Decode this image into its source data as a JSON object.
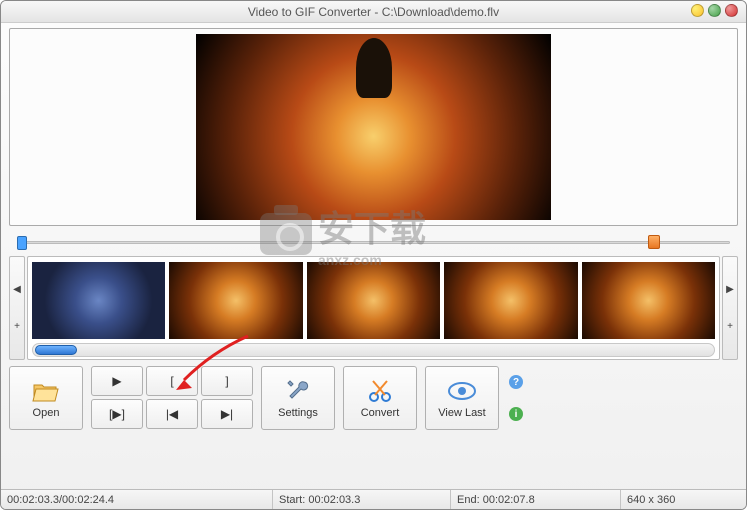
{
  "title": "Video to GIF Converter - C:\\Download\\demo.flv",
  "buttons": {
    "open": "Open",
    "settings": "Settings",
    "convert": "Convert",
    "viewlast": "View Last"
  },
  "playgrid": {
    "play": "▶",
    "mark_in": "[",
    "mark_out": "]",
    "step_play": "[▶]",
    "prev": "|◀",
    "next": "▶|"
  },
  "status": {
    "range": "00:02:03.3/00:02:24.4",
    "start_label": "Start:",
    "start": "00:02:03.3",
    "end_label": "End:",
    "end": "00:02:07.8",
    "dim": "640 x 360"
  },
  "watermark": {
    "main": "安下载",
    "sub": "anxz.com"
  }
}
